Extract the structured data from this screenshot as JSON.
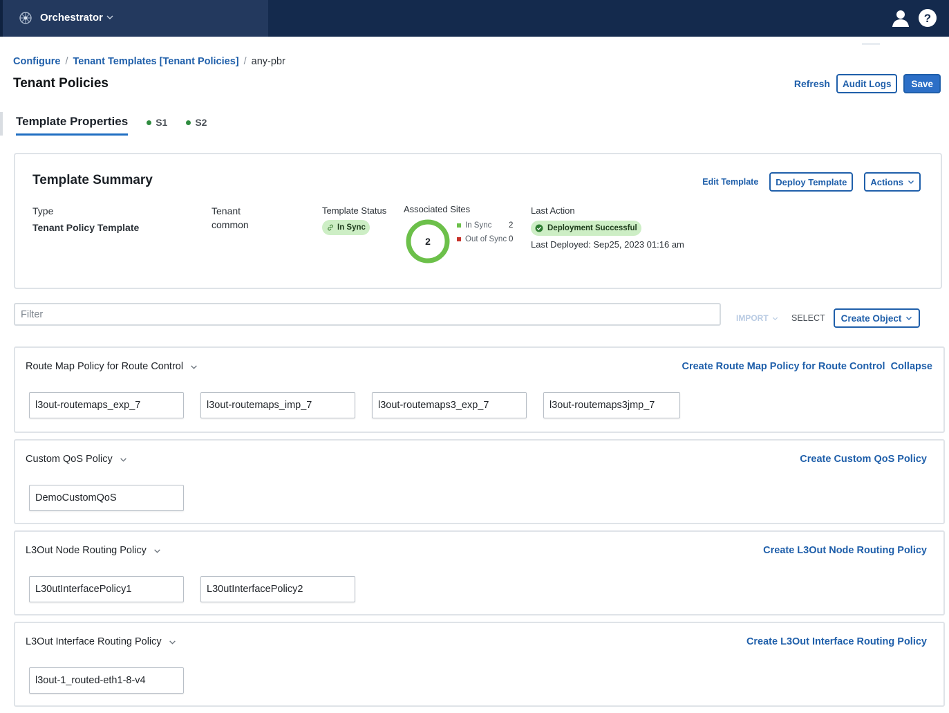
{
  "topbar": {
    "app_name": "Orchestrator",
    "icons": {
      "app": "orchestrator-logo-icon",
      "chevron": "chevron-down-icon",
      "user": "user-icon",
      "help": "help-icon"
    },
    "colors": {
      "background": "#142a4d",
      "app_area": "#23395e"
    }
  },
  "breadcrumb": {
    "items": [
      "Configure",
      "Tenant Templates [Tenant Policies]",
      "any-pbr"
    ],
    "separator": "/"
  },
  "header": {
    "title": "Tenant Policies",
    "refresh_label": "Refresh",
    "audit_logs_label": "Audit Logs",
    "save_label": "Save"
  },
  "tabs": [
    {
      "label": "Template Properties",
      "active": true
    },
    {
      "label": "S1",
      "active": false,
      "status_color": "#2e8b3e"
    },
    {
      "label": "S2",
      "active": false,
      "status_color": "#2e8b3e"
    }
  ],
  "summary": {
    "title": "Template Summary",
    "edit_label": "Edit Template",
    "deploy_label": "Deploy Template",
    "actions_label": "Actions",
    "type_label": "Type",
    "type_value": "Tenant Policy Template",
    "tenant_label": "Tenant",
    "tenant_value": "common",
    "status_label": "Template Status",
    "status_value": "In Sync",
    "sites_label": "Associated Sites",
    "sites_total": "2",
    "sites_in_sync_label": "In Sync",
    "sites_in_sync_count": "2",
    "sites_out_sync_label": "Out of Sync",
    "sites_out_sync_count": "0",
    "last_action_label": "Last Action",
    "last_action_value": "Deployment Successful",
    "last_deployed": "Last Deployed: Sep25, 2023 01:16 am",
    "colors": {
      "in_sync": "#6cc04a",
      "out_sync": "#c8322a",
      "pill_bg": "#cdeec5"
    }
  },
  "toolbar": {
    "filter_placeholder": "Filter",
    "import_label": "IMPORT",
    "select_label": "SELECT",
    "create_object_label": "Create Object"
  },
  "sections": {
    "route_map": {
      "title": "Route Map Policy for Route Control",
      "create_label": "Create Route Map Policy for Route Control",
      "collapse_label": "Collapse",
      "items": [
        "l3out-routemaps_exp_7",
        "l3out-routemaps_imp_7",
        "l3out-routemaps3_exp_7",
        "l3out-routemaps3jmp_7"
      ]
    },
    "qos": {
      "title": "Custom QoS Policy",
      "create_label": "Create Custom QoS Policy",
      "items": [
        "DemoCustomQoS"
      ]
    },
    "node_routing": {
      "title": "L3Out Node Routing Policy",
      "create_label": "Create L3Out Node Routing Policy",
      "items": [
        "L30utInterfacePolicy1",
        "L30utInterfacePolicy2"
      ]
    },
    "interface_routing": {
      "title": "L3Out Interface Routing Policy",
      "create_label": "Create L3Out Interface Routing Policy",
      "items": [
        "l3out-1_routed-eth1-8-v4"
      ]
    }
  },
  "accent_color": "#1f5faa"
}
